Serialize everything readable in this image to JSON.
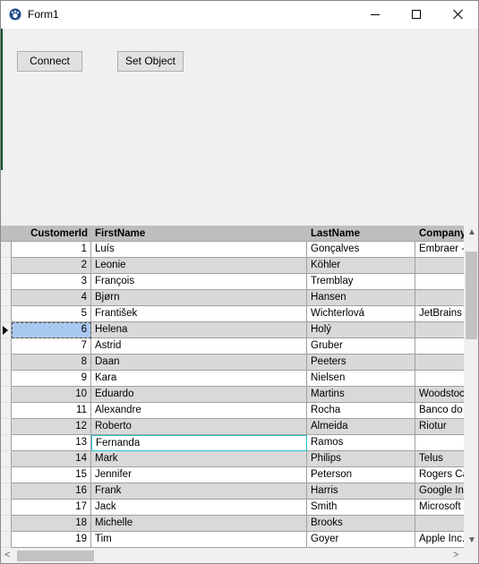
{
  "window": {
    "title": "Form1"
  },
  "toolbar": {
    "connect_label": "Connect",
    "set_object_label": "Set Object"
  },
  "grid": {
    "columns": [
      "CustomerId",
      "FirstName",
      "LastName",
      "Company"
    ],
    "header_labels": {
      "customer_id": "CustomerId",
      "first_name": "FirstName",
      "last_name": "LastName",
      "company": "Company"
    },
    "rows": [
      {
        "id": "1",
        "first": "Luís",
        "last": "Gonçalves",
        "company": "Embraer - Empresa Brasileira"
      },
      {
        "id": "2",
        "first": "Leonie",
        "last": "Köhler",
        "company": ""
      },
      {
        "id": "3",
        "first": "François",
        "last": "Tremblay",
        "company": ""
      },
      {
        "id": "4",
        "first": "Bjørn",
        "last": "Hansen",
        "company": ""
      },
      {
        "id": "5",
        "first": "František",
        "last": "Wichterlová",
        "company": "JetBrains s.r.o."
      },
      {
        "id": "6",
        "first": "Helena",
        "last": "Holý",
        "company": ""
      },
      {
        "id": "7",
        "first": "Astrid",
        "last": "Gruber",
        "company": ""
      },
      {
        "id": "8",
        "first": "Daan",
        "last": "Peeters",
        "company": ""
      },
      {
        "id": "9",
        "first": "Kara",
        "last": "Nielsen",
        "company": ""
      },
      {
        "id": "10",
        "first": "Eduardo",
        "last": "Martins",
        "company": "Woodstock Discos"
      },
      {
        "id": "11",
        "first": "Alexandre",
        "last": "Rocha",
        "company": "Banco do Brasil S.A."
      },
      {
        "id": "12",
        "first": "Roberto",
        "last": "Almeida",
        "company": "Riotur"
      },
      {
        "id": "13",
        "first": "Fernanda",
        "last": "Ramos",
        "company": ""
      },
      {
        "id": "14",
        "first": "Mark",
        "last": "Philips",
        "company": "Telus"
      },
      {
        "id": "15",
        "first": "Jennifer",
        "last": "Peterson",
        "company": "Rogers Canada"
      },
      {
        "id": "16",
        "first": "Frank",
        "last": "Harris",
        "company": "Google Inc."
      },
      {
        "id": "17",
        "first": "Jack",
        "last": "Smith",
        "company": "Microsoft Corporation"
      },
      {
        "id": "18",
        "first": "Michelle",
        "last": "Brooks",
        "company": ""
      },
      {
        "id": "19",
        "first": "Tim",
        "last": "Goyer",
        "company": "Apple Inc."
      }
    ],
    "current_row": "6",
    "focused_row": "13"
  },
  "colors": {
    "selected_cell": "#a9c8f0",
    "focus_border": "#26c4d2",
    "alt_row": "#d9d9d9",
    "header_bg": "#bebebe"
  }
}
